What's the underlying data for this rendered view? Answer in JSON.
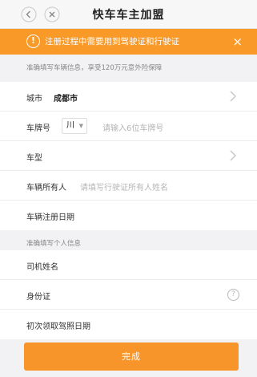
{
  "navbar": {
    "title": "快车车主加盟",
    "back_icon": "chevron-left-icon",
    "close_icon": "close-icon"
  },
  "notice": {
    "text": "注册过程中需要用到驾驶证和行驶证",
    "icon": "alert-circle-icon",
    "background": "#f99a28"
  },
  "vehicle_section": {
    "header": "准确填写车辆信息，享受120万元意外险保障",
    "city": {
      "label": "城市",
      "value": "成都市"
    },
    "plate": {
      "label": "车牌号",
      "province": "川",
      "placeholder": "请输入6位车牌号"
    },
    "model": {
      "label": "车型"
    },
    "owner": {
      "label": "车辆所有人",
      "placeholder": "请填写行驶证所有人姓名"
    },
    "reg_date": {
      "label": "车辆注册日期"
    }
  },
  "personal_section": {
    "header": "准确填写个人信息",
    "driver_name": {
      "label": "司机姓名"
    },
    "id_card": {
      "label": "身份证",
      "help_icon": "question-circle-icon"
    },
    "license_date": {
      "label": "初次领取驾照日期"
    }
  },
  "submit": {
    "label": "完成",
    "color": "#f7952a"
  }
}
